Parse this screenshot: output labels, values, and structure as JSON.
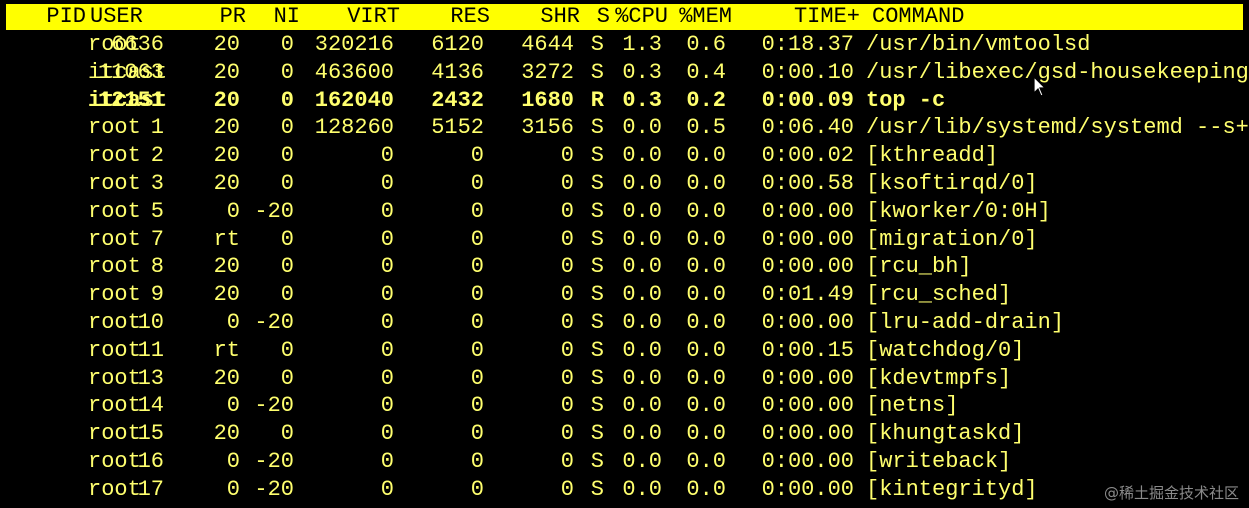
{
  "header": {
    "pid": "PID",
    "user": "USER",
    "pr": "PR",
    "ni": "NI",
    "virt": "VIRT",
    "res": "RES",
    "shr": "SHR",
    "s": "S",
    "cpu": "%CPU",
    "mem": "%MEM",
    "time": "TIME+",
    "command": "COMMAND"
  },
  "processes": [
    {
      "pid": "6636",
      "user": "root",
      "pr": "20",
      "ni": "0",
      "virt": "320216",
      "res": "6120",
      "shr": "4644",
      "s": "S",
      "cpu": "1.3",
      "mem": "0.6",
      "time": "0:18.37",
      "command": "/usr/bin/vmtoolsd"
    },
    {
      "pid": "11063",
      "user": "itcast",
      "pr": "20",
      "ni": "0",
      "virt": "463600",
      "res": "4136",
      "shr": "3272",
      "s": "S",
      "cpu": "0.3",
      "mem": "0.4",
      "time": "0:00.10",
      "command": "/usr/libexec/gsd-housekeeping"
    },
    {
      "pid": "12151",
      "user": "itcast",
      "pr": "20",
      "ni": "0",
      "virt": "162040",
      "res": "2432",
      "shr": "1680",
      "s": "R",
      "cpu": "0.3",
      "mem": "0.2",
      "time": "0:00.09",
      "command": "top -c"
    },
    {
      "pid": "1",
      "user": "root",
      "pr": "20",
      "ni": "0",
      "virt": "128260",
      "res": "5152",
      "shr": "3156",
      "s": "S",
      "cpu": "0.0",
      "mem": "0.5",
      "time": "0:06.40",
      "command": "/usr/lib/systemd/systemd --s+"
    },
    {
      "pid": "2",
      "user": "root",
      "pr": "20",
      "ni": "0",
      "virt": "0",
      "res": "0",
      "shr": "0",
      "s": "S",
      "cpu": "0.0",
      "mem": "0.0",
      "time": "0:00.02",
      "command": "[kthreadd]"
    },
    {
      "pid": "3",
      "user": "root",
      "pr": "20",
      "ni": "0",
      "virt": "0",
      "res": "0",
      "shr": "0",
      "s": "S",
      "cpu": "0.0",
      "mem": "0.0",
      "time": "0:00.58",
      "command": "[ksoftirqd/0]"
    },
    {
      "pid": "5",
      "user": "root",
      "pr": "0",
      "ni": "-20",
      "virt": "0",
      "res": "0",
      "shr": "0",
      "s": "S",
      "cpu": "0.0",
      "mem": "0.0",
      "time": "0:00.00",
      "command": "[kworker/0:0H]"
    },
    {
      "pid": "7",
      "user": "root",
      "pr": "rt",
      "ni": "0",
      "virt": "0",
      "res": "0",
      "shr": "0",
      "s": "S",
      "cpu": "0.0",
      "mem": "0.0",
      "time": "0:00.00",
      "command": "[migration/0]"
    },
    {
      "pid": "8",
      "user": "root",
      "pr": "20",
      "ni": "0",
      "virt": "0",
      "res": "0",
      "shr": "0",
      "s": "S",
      "cpu": "0.0",
      "mem": "0.0",
      "time": "0:00.00",
      "command": "[rcu_bh]"
    },
    {
      "pid": "9",
      "user": "root",
      "pr": "20",
      "ni": "0",
      "virt": "0",
      "res": "0",
      "shr": "0",
      "s": "S",
      "cpu": "0.0",
      "mem": "0.0",
      "time": "0:01.49",
      "command": "[rcu_sched]"
    },
    {
      "pid": "10",
      "user": "root",
      "pr": "0",
      "ni": "-20",
      "virt": "0",
      "res": "0",
      "shr": "0",
      "s": "S",
      "cpu": "0.0",
      "mem": "0.0",
      "time": "0:00.00",
      "command": "[lru-add-drain]"
    },
    {
      "pid": "11",
      "user": "root",
      "pr": "rt",
      "ni": "0",
      "virt": "0",
      "res": "0",
      "shr": "0",
      "s": "S",
      "cpu": "0.0",
      "mem": "0.0",
      "time": "0:00.15",
      "command": "[watchdog/0]"
    },
    {
      "pid": "13",
      "user": "root",
      "pr": "20",
      "ni": "0",
      "virt": "0",
      "res": "0",
      "shr": "0",
      "s": "S",
      "cpu": "0.0",
      "mem": "0.0",
      "time": "0:00.00",
      "command": "[kdevtmpfs]"
    },
    {
      "pid": "14",
      "user": "root",
      "pr": "0",
      "ni": "-20",
      "virt": "0",
      "res": "0",
      "shr": "0",
      "s": "S",
      "cpu": "0.0",
      "mem": "0.0",
      "time": "0:00.00",
      "command": "[netns]"
    },
    {
      "pid": "15",
      "user": "root",
      "pr": "20",
      "ni": "0",
      "virt": "0",
      "res": "0",
      "shr": "0",
      "s": "S",
      "cpu": "0.0",
      "mem": "0.0",
      "time": "0:00.00",
      "command": "[khungtaskd]"
    },
    {
      "pid": "16",
      "user": "root",
      "pr": "0",
      "ni": "-20",
      "virt": "0",
      "res": "0",
      "shr": "0",
      "s": "S",
      "cpu": "0.0",
      "mem": "0.0",
      "time": "0:00.00",
      "command": "[writeback]"
    },
    {
      "pid": "17",
      "user": "root",
      "pr": "0",
      "ni": "-20",
      "virt": "0",
      "res": "0",
      "shr": "0",
      "s": "S",
      "cpu": "0.0",
      "mem": "0.0",
      "time": "0:00.00",
      "command": "[kintegrityd]"
    }
  ],
  "current_process_pid": "12151",
  "watermark": "@稀土掘金技术社区",
  "colors": {
    "background": "#000000",
    "text": "#ffff6e",
    "header_bg": "#ffff00",
    "header_text": "#000000"
  },
  "icons": {
    "cursor": "mouse-pointer-icon"
  }
}
